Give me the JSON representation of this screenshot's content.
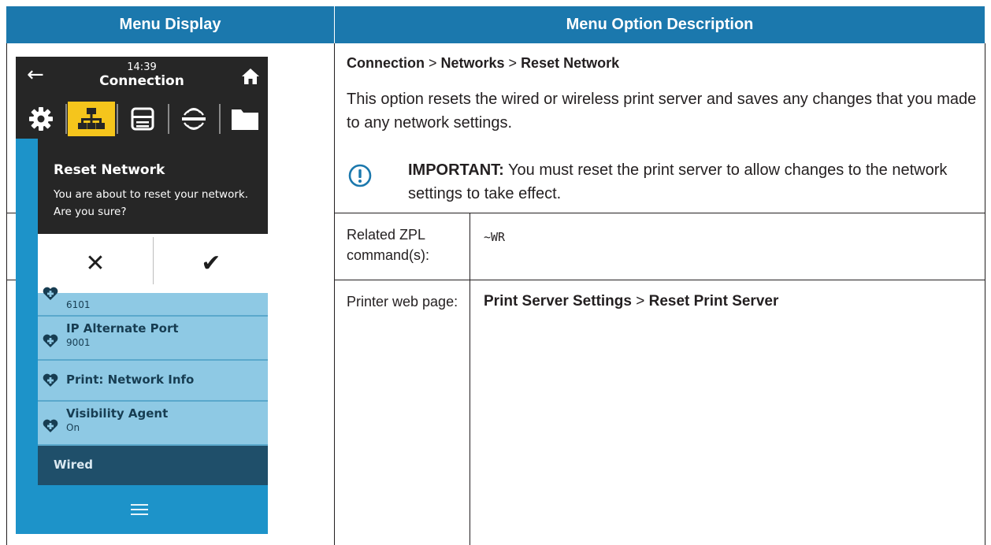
{
  "table": {
    "header_left": "Menu Display",
    "header_right": "Menu Option Description"
  },
  "colors": {
    "header_blue": "#1b78ad",
    "tab_yellow": "#f5c51c",
    "screen_blue": "#1d93c9"
  },
  "description": {
    "path": {
      "p1": "Connection",
      "sep1": " > ",
      "p2": "Networks",
      "sep2": " > ",
      "p3": "Reset Network"
    },
    "text": "This option resets the wired or wireless print server and saves any changes that you made to any network settings.",
    "important_label": "IMPORTANT:",
    "important_text": " You must reset the print server to allow changes to the network settings to take effect."
  },
  "rows": {
    "zpl_label": "Related ZPL command(s):",
    "zpl_value": "~WR",
    "web_label": "Printer web page:",
    "web_value": {
      "p1": "Print Server Settings",
      "sep": " > ",
      "p2": "Reset Print Server"
    }
  },
  "screen": {
    "time": "14:39",
    "title": "Connection",
    "icons": {
      "back": "back-arrow-icon",
      "home": "home-icon",
      "tabs": [
        "settings-icon",
        "network-icon",
        "printer-icon",
        "wireless-icon",
        "folder-icon"
      ]
    },
    "dialog": {
      "title": "Reset Network",
      "message": "You are about to reset your network. Are you sure?",
      "cancel_glyph": "✕",
      "confirm_glyph": "✔"
    },
    "items": [
      {
        "name": "",
        "value": "6101"
      },
      {
        "name": "IP Alternate Port",
        "value": "9001"
      },
      {
        "name": "Print: Network Info",
        "value": ""
      },
      {
        "name": "Visibility Agent",
        "value": "On"
      }
    ],
    "section": "Wired"
  }
}
